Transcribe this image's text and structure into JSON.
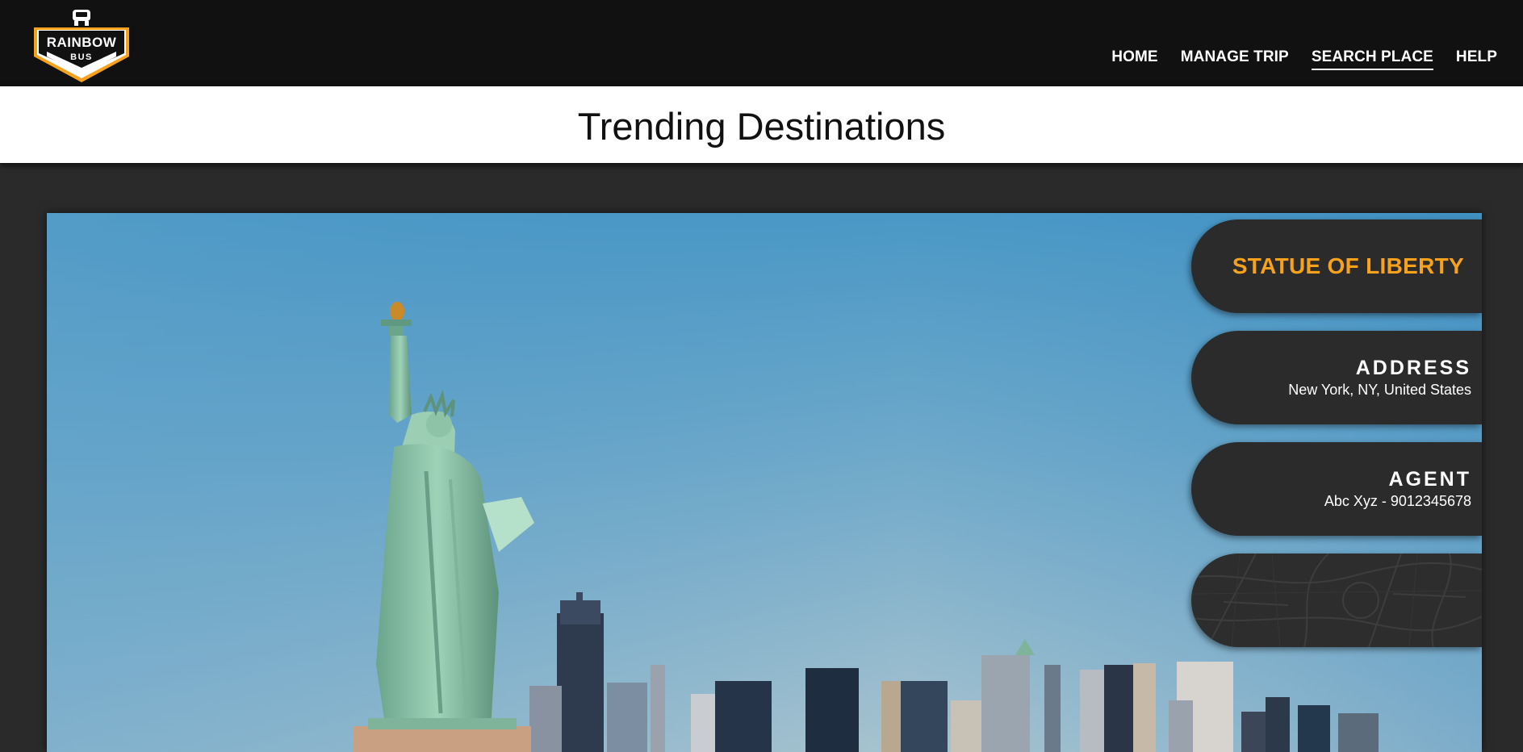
{
  "header": {
    "logo": {
      "brand": "RAINBOW",
      "sub": "BUS",
      "icon": "bus-logo-icon"
    },
    "nav": [
      {
        "label": "HOME",
        "active": false
      },
      {
        "label": "MANAGE TRIP",
        "active": false
      },
      {
        "label": "SEARCH PLACE",
        "active": true
      },
      {
        "label": "HELP",
        "active": false
      }
    ]
  },
  "page": {
    "title": "Trending Destinations"
  },
  "destination": {
    "name": "STATUE OF LIBERTY",
    "address_label": "ADDRESS",
    "address": "New York, NY, United States",
    "agent_label": "AGENT",
    "agent": "Abc Xyz - 9012345678",
    "map_icon": "map-icon"
  },
  "colors": {
    "header_bg": "#111111",
    "accent": "#f7a21c",
    "panel_bg": "#2b2b2b",
    "page_bg": "#2a2a2a"
  }
}
